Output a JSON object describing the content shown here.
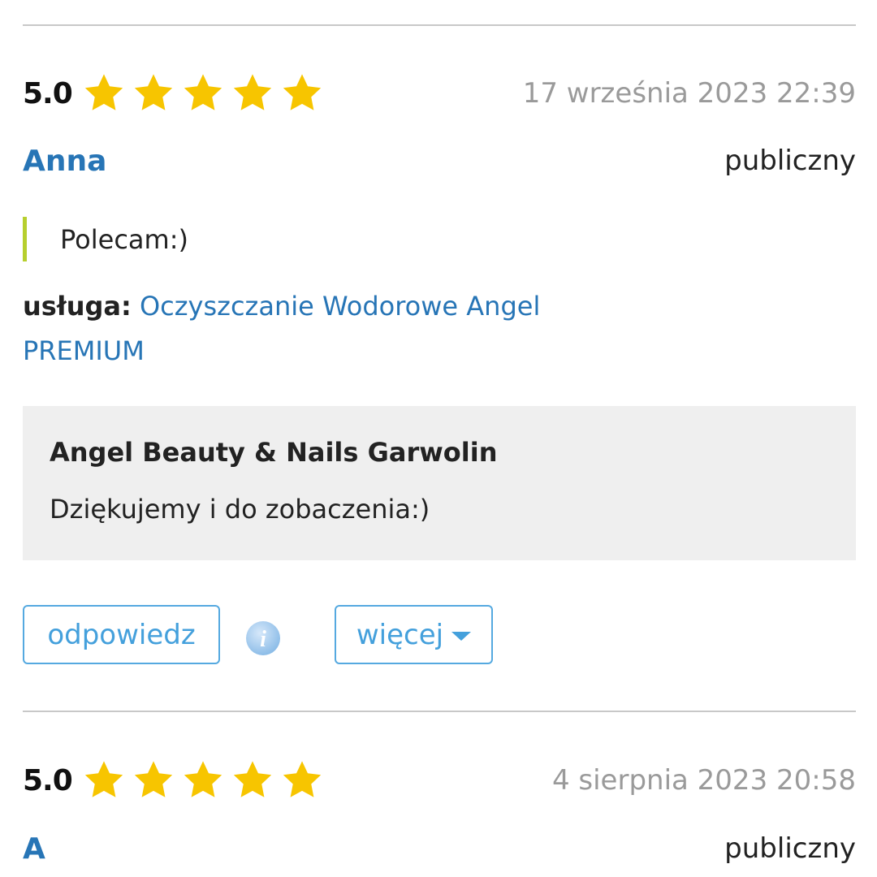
{
  "reviews": [
    {
      "score": "5.0",
      "stars": 5,
      "date": "17 września 2023 22:39",
      "author": "Anna",
      "visibility": "publiczny",
      "comment": "Polecam:)",
      "service_label": "usługa:",
      "service_name": "Oczyszczanie Wodorowe Angel PREMIUM",
      "reply": {
        "author": "Angel Beauty & Nails Garwolin",
        "text": "Dziękujemy i do zobaczenia:)"
      },
      "actions": {
        "reply_label": "odpowiedz",
        "more_label": "więcej"
      }
    },
    {
      "score": "5.0",
      "stars": 5,
      "date": "4 sierpnia 2023 20:58",
      "author": "A",
      "visibility": "publiczny"
    }
  ],
  "colors": {
    "star": "#f7c500",
    "link": "#2775b6",
    "button": "#44a0dc",
    "comment_bar": "#b7cf2e",
    "reply_bg": "#efefef",
    "date": "#9a9a9a"
  },
  "icons": {
    "star": "star-icon",
    "info": "info-icon",
    "caret": "caret-down-icon"
  }
}
